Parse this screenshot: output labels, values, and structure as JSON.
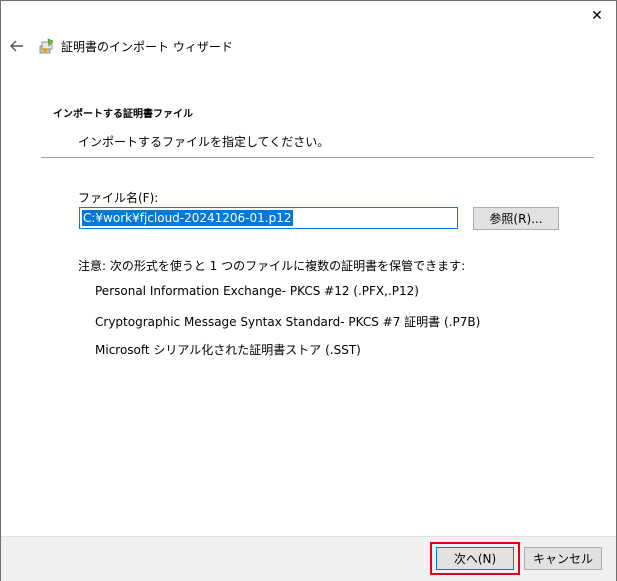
{
  "window": {
    "close_glyph": "✕",
    "title": "証明書のインポート ウィザード"
  },
  "page": {
    "heading": "インポートする証明書ファイル",
    "subheading": "インポートするファイルを指定してください。"
  },
  "file": {
    "label": "ファイル名(F):",
    "value": "C:¥work¥fjcloud-20241206-01.p12",
    "browse_label": "参照(R)..."
  },
  "note": {
    "text": "注意: 次の形式を使うと 1 つのファイルに複数の証明書を保管できます:",
    "formats": [
      "Personal Information Exchange- PKCS #12 (.PFX,.P12)",
      "Cryptographic Message Syntax Standard- PKCS #7 証明書 (.P7B)",
      "Microsoft シリアル化された証明書ストア (.SST)"
    ]
  },
  "footer": {
    "next_label": "次へ(N)",
    "cancel_label": "キャンセル"
  },
  "colors": {
    "accent": "#0078d7",
    "highlight": "#e0001a",
    "footer_bg": "#f0f0f0"
  },
  "icons": {
    "back": "back-arrow-icon",
    "wizard": "certificate-wizard-icon",
    "close": "close-icon"
  }
}
